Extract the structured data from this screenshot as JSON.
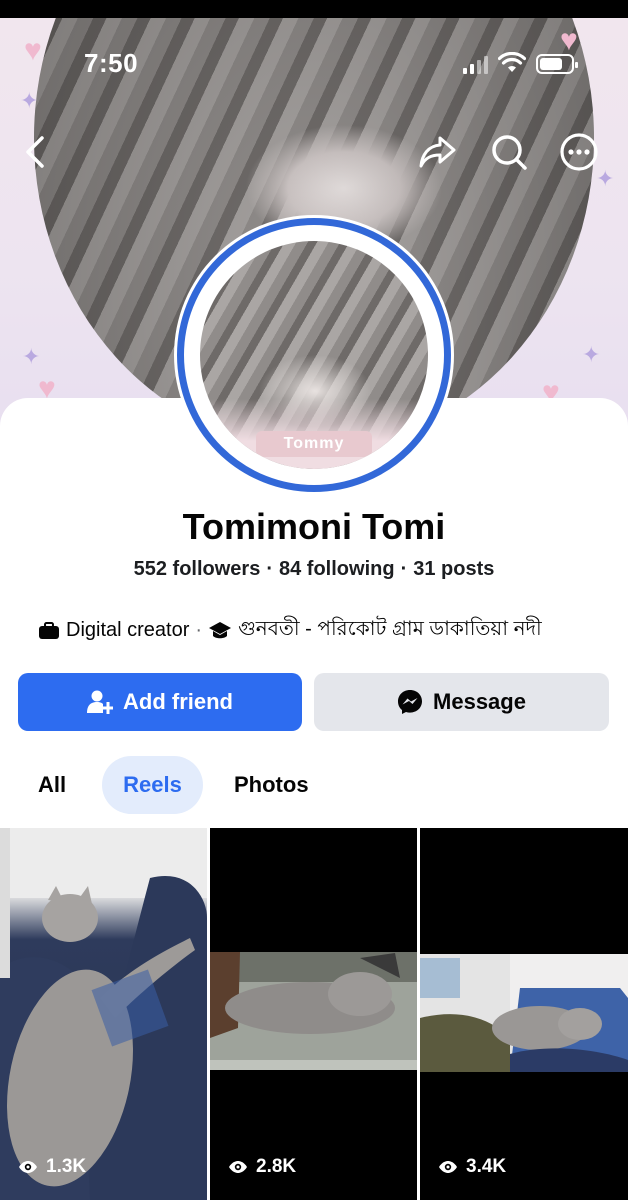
{
  "status_bar": {
    "time": "7:50"
  },
  "profile": {
    "name": "Tomimoni Tomi",
    "avatar_tag": "Tommy",
    "stats": {
      "followers": "552 followers",
      "following": "84 following",
      "posts": "31 posts"
    },
    "bio": {
      "category": "Digital creator",
      "education": "গুনবতী - পরিকোট গ্রাম ডাকাতিয়া নদী"
    }
  },
  "actions": {
    "add_friend": "Add friend",
    "message": "Message"
  },
  "tabs": [
    {
      "label": "All",
      "active": false
    },
    {
      "label": "Reels",
      "active": true
    },
    {
      "label": "Photos",
      "active": false
    }
  ],
  "reels": [
    {
      "views": "1.3K"
    },
    {
      "views": "2.8K"
    },
    {
      "views": "3.4K"
    }
  ],
  "colors": {
    "accent": "#2d6cf0",
    "ring": "#3268d8",
    "secondary_button": "#e4e6eb",
    "active_tab_bg": "#e3ecfc"
  },
  "icons": [
    "back-icon",
    "share-icon",
    "search-icon",
    "more-icon",
    "add-friend-icon",
    "messenger-icon",
    "eye-icon",
    "briefcase-icon",
    "graduation-cap-icon",
    "wifi-icon",
    "battery-icon",
    "signal-icon"
  ]
}
